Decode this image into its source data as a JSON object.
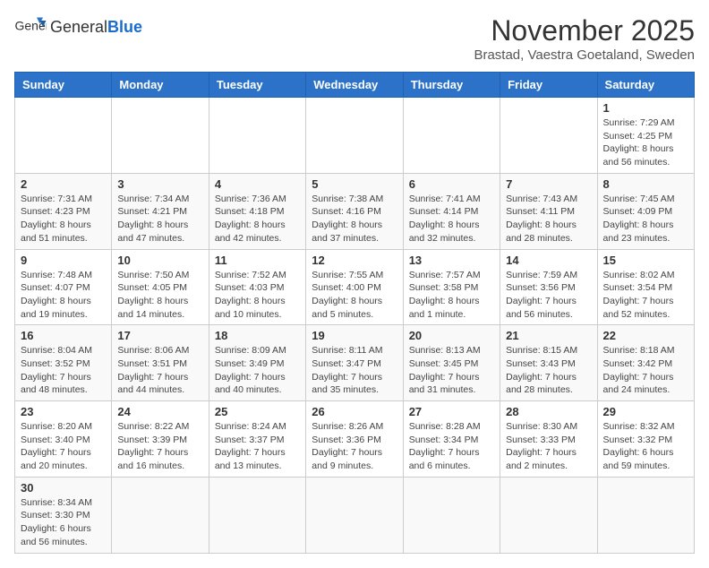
{
  "header": {
    "logo_text_normal": "General",
    "logo_text_blue": "Blue",
    "month_title": "November 2025",
    "location": "Brastad, Vaestra Goetaland, Sweden"
  },
  "weekdays": [
    "Sunday",
    "Monday",
    "Tuesday",
    "Wednesday",
    "Thursday",
    "Friday",
    "Saturday"
  ],
  "weeks": [
    [
      {
        "day": "",
        "info": ""
      },
      {
        "day": "",
        "info": ""
      },
      {
        "day": "",
        "info": ""
      },
      {
        "day": "",
        "info": ""
      },
      {
        "day": "",
        "info": ""
      },
      {
        "day": "",
        "info": ""
      },
      {
        "day": "1",
        "info": "Sunrise: 7:29 AM\nSunset: 4:25 PM\nDaylight: 8 hours and 56 minutes."
      }
    ],
    [
      {
        "day": "2",
        "info": "Sunrise: 7:31 AM\nSunset: 4:23 PM\nDaylight: 8 hours and 51 minutes."
      },
      {
        "day": "3",
        "info": "Sunrise: 7:34 AM\nSunset: 4:21 PM\nDaylight: 8 hours and 47 minutes."
      },
      {
        "day": "4",
        "info": "Sunrise: 7:36 AM\nSunset: 4:18 PM\nDaylight: 8 hours and 42 minutes."
      },
      {
        "day": "5",
        "info": "Sunrise: 7:38 AM\nSunset: 4:16 PM\nDaylight: 8 hours and 37 minutes."
      },
      {
        "day": "6",
        "info": "Sunrise: 7:41 AM\nSunset: 4:14 PM\nDaylight: 8 hours and 32 minutes."
      },
      {
        "day": "7",
        "info": "Sunrise: 7:43 AM\nSunset: 4:11 PM\nDaylight: 8 hours and 28 minutes."
      },
      {
        "day": "8",
        "info": "Sunrise: 7:45 AM\nSunset: 4:09 PM\nDaylight: 8 hours and 23 minutes."
      }
    ],
    [
      {
        "day": "9",
        "info": "Sunrise: 7:48 AM\nSunset: 4:07 PM\nDaylight: 8 hours and 19 minutes."
      },
      {
        "day": "10",
        "info": "Sunrise: 7:50 AM\nSunset: 4:05 PM\nDaylight: 8 hours and 14 minutes."
      },
      {
        "day": "11",
        "info": "Sunrise: 7:52 AM\nSunset: 4:03 PM\nDaylight: 8 hours and 10 minutes."
      },
      {
        "day": "12",
        "info": "Sunrise: 7:55 AM\nSunset: 4:00 PM\nDaylight: 8 hours and 5 minutes."
      },
      {
        "day": "13",
        "info": "Sunrise: 7:57 AM\nSunset: 3:58 PM\nDaylight: 8 hours and 1 minute."
      },
      {
        "day": "14",
        "info": "Sunrise: 7:59 AM\nSunset: 3:56 PM\nDaylight: 7 hours and 56 minutes."
      },
      {
        "day": "15",
        "info": "Sunrise: 8:02 AM\nSunset: 3:54 PM\nDaylight: 7 hours and 52 minutes."
      }
    ],
    [
      {
        "day": "16",
        "info": "Sunrise: 8:04 AM\nSunset: 3:52 PM\nDaylight: 7 hours and 48 minutes."
      },
      {
        "day": "17",
        "info": "Sunrise: 8:06 AM\nSunset: 3:51 PM\nDaylight: 7 hours and 44 minutes."
      },
      {
        "day": "18",
        "info": "Sunrise: 8:09 AM\nSunset: 3:49 PM\nDaylight: 7 hours and 40 minutes."
      },
      {
        "day": "19",
        "info": "Sunrise: 8:11 AM\nSunset: 3:47 PM\nDaylight: 7 hours and 35 minutes."
      },
      {
        "day": "20",
        "info": "Sunrise: 8:13 AM\nSunset: 3:45 PM\nDaylight: 7 hours and 31 minutes."
      },
      {
        "day": "21",
        "info": "Sunrise: 8:15 AM\nSunset: 3:43 PM\nDaylight: 7 hours and 28 minutes."
      },
      {
        "day": "22",
        "info": "Sunrise: 8:18 AM\nSunset: 3:42 PM\nDaylight: 7 hours and 24 minutes."
      }
    ],
    [
      {
        "day": "23",
        "info": "Sunrise: 8:20 AM\nSunset: 3:40 PM\nDaylight: 7 hours and 20 minutes."
      },
      {
        "day": "24",
        "info": "Sunrise: 8:22 AM\nSunset: 3:39 PM\nDaylight: 7 hours and 16 minutes."
      },
      {
        "day": "25",
        "info": "Sunrise: 8:24 AM\nSunset: 3:37 PM\nDaylight: 7 hours and 13 minutes."
      },
      {
        "day": "26",
        "info": "Sunrise: 8:26 AM\nSunset: 3:36 PM\nDaylight: 7 hours and 9 minutes."
      },
      {
        "day": "27",
        "info": "Sunrise: 8:28 AM\nSunset: 3:34 PM\nDaylight: 7 hours and 6 minutes."
      },
      {
        "day": "28",
        "info": "Sunrise: 8:30 AM\nSunset: 3:33 PM\nDaylight: 7 hours and 2 minutes."
      },
      {
        "day": "29",
        "info": "Sunrise: 8:32 AM\nSunset: 3:32 PM\nDaylight: 6 hours and 59 minutes."
      }
    ],
    [
      {
        "day": "30",
        "info": "Sunrise: 8:34 AM\nSunset: 3:30 PM\nDaylight: 6 hours and 56 minutes."
      },
      {
        "day": "",
        "info": ""
      },
      {
        "day": "",
        "info": ""
      },
      {
        "day": "",
        "info": ""
      },
      {
        "day": "",
        "info": ""
      },
      {
        "day": "",
        "info": ""
      },
      {
        "day": "",
        "info": ""
      }
    ]
  ]
}
